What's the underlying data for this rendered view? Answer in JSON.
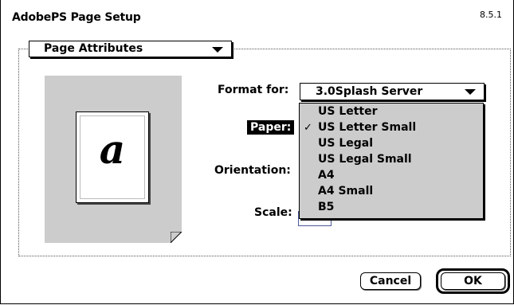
{
  "dialog": {
    "title": "AdobePS Page Setup",
    "version": "8.5.1"
  },
  "section_popup": {
    "label": "Page Attributes"
  },
  "preview": {
    "letter": "a"
  },
  "fields": {
    "format_label": "Format for:",
    "paper_label": "Paper:",
    "orientation_label": "Orientation:",
    "scale_label": "Scale:"
  },
  "format_popup": {
    "selected": "3.0Splash Server"
  },
  "paper_menu": {
    "items": [
      {
        "label": "US Letter",
        "checked": false
      },
      {
        "label": "US Letter Small",
        "checked": true
      },
      {
        "label": "US Legal",
        "checked": false
      },
      {
        "label": "US Legal Small",
        "checked": false
      },
      {
        "label": "A4",
        "checked": false
      },
      {
        "label": "A4 Small",
        "checked": false
      },
      {
        "label": "B5",
        "checked": false
      }
    ],
    "check_glyph": "✓"
  },
  "buttons": {
    "cancel": "Cancel",
    "ok": "OK"
  },
  "colors": {
    "menu_background": "#cccccc",
    "preview_background": "#cccccc",
    "highlight": "#000000"
  },
  "icons": {
    "popup_arrow": "chevron-down-icon",
    "checkmark": "checkmark-icon"
  }
}
